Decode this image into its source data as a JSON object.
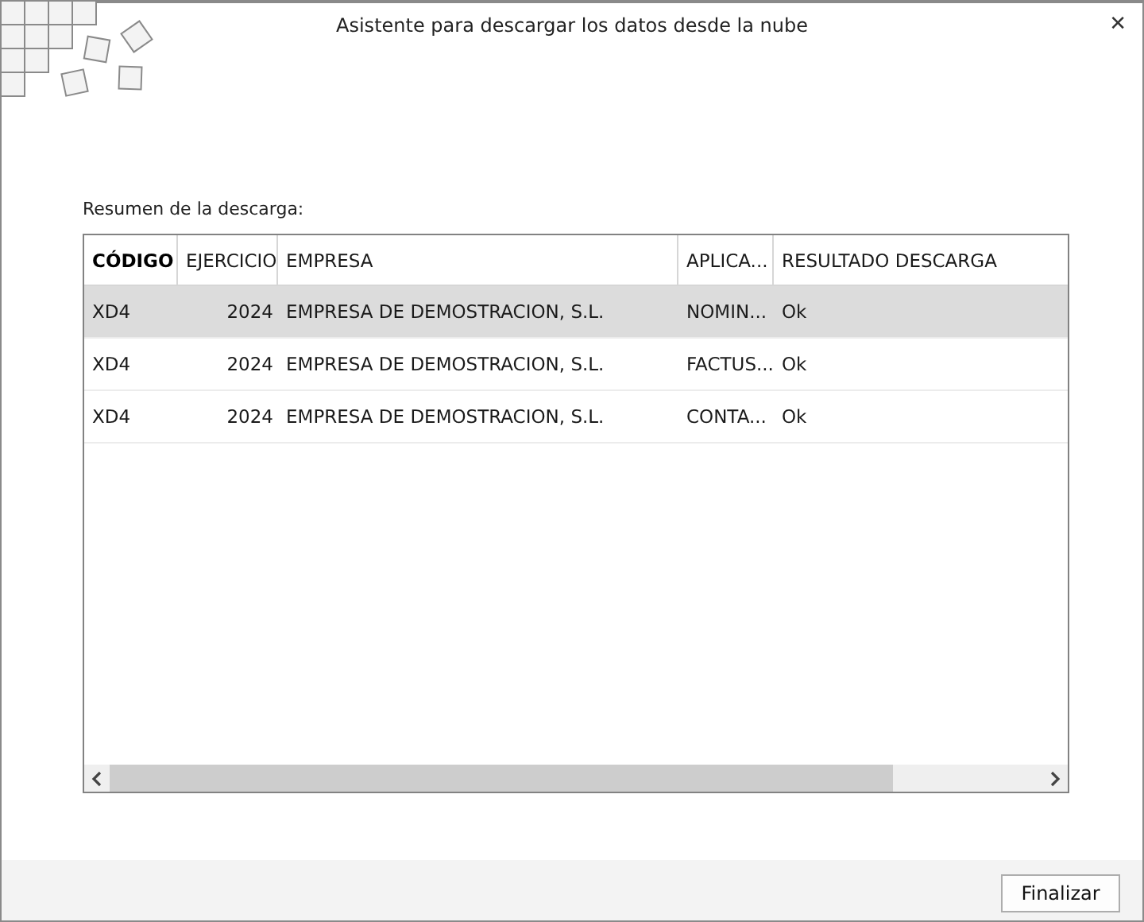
{
  "window": {
    "title": "Asistente para descargar los datos desde la nube",
    "close": "✕"
  },
  "summary_label": "Resumen de la descarga:",
  "table": {
    "columns": [
      {
        "label": "CÓDIGO",
        "sorted": true
      },
      {
        "label": "EJERCICIO",
        "sorted": false
      },
      {
        "label": "EMPRESA",
        "sorted": false
      },
      {
        "label": "APLICA...",
        "sorted": false
      },
      {
        "label": "RESULTADO DESCARGA",
        "sorted": false
      }
    ],
    "rows": [
      {
        "selected": true,
        "cells": [
          "XD4",
          "2024",
          "EMPRESA DE DEMOSTRACION, S.L.",
          "NOMIN...",
          "Ok"
        ]
      },
      {
        "selected": false,
        "cells": [
          "XD4",
          "2024",
          "EMPRESA DE DEMOSTRACION, S.L.",
          "FACTUS...",
          "Ok"
        ]
      },
      {
        "selected": false,
        "cells": [
          "XD4",
          "2024",
          "EMPRESA DE DEMOSTRACION, S.L.",
          "CONTA...",
          "Ok"
        ]
      }
    ]
  },
  "buttons": [
    {
      "label": "Finalizar"
    }
  ]
}
